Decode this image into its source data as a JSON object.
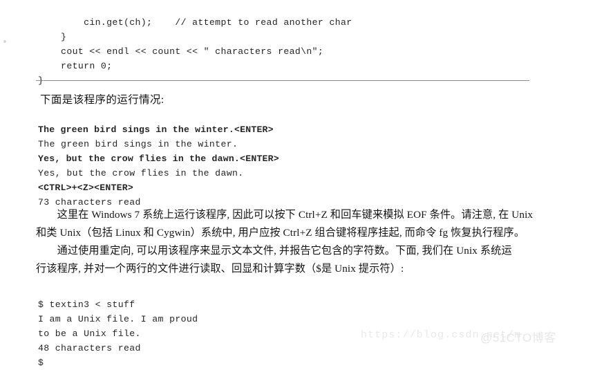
{
  "page": {
    "background_color": "#ffffff",
    "text_color": "#151515",
    "rule_color": "#8d8d8d"
  },
  "code_top": {
    "name": "cpp-source-fragment",
    "lines": [
      "        cin.get(ch);    // attempt to read another char",
      "    }",
      "    cout << endl << count << \" characters read\\n\";",
      "    return 0;",
      "}"
    ]
  },
  "heading": {
    "text": "下面是该程序的运行情况:"
  },
  "run_block": {
    "name": "program-run-transcript",
    "lines": [
      {
        "text": "The green bird sings in the winter.<ENTER>",
        "bold": true
      },
      {
        "text": "The green bird sings in the winter.",
        "bold": false
      },
      {
        "text": "Yes, but the crow flies in the dawn.<ENTER>",
        "bold": true
      },
      {
        "text": "Yes, but the crow flies in the dawn.",
        "bold": false
      },
      {
        "text": "<CTRL>+<Z><ENTER>",
        "bold": true
      },
      {
        "text": "73 characters read",
        "bold": false
      }
    ]
  },
  "paragraph_1": {
    "line_1": "　　这里在 Windows 7 系统上运行该程序, 因此可以按下 Ctrl+Z 和回车键来模拟 EOF 条件。请注意, 在 Unix",
    "line_2": "和类 Unix（包括 Linux 和 Cygwin）系统中, 用户应按 Ctrl+Z 组合键将程序挂起, 而命令 fg 恢复执行程序。"
  },
  "paragraph_2": {
    "line_1": "　　通过使用重定向, 可以用该程序来显示文本文件, 并报告它包含的字符数。下面, 我们在 Unix 系统运",
    "line_2": "行该程序, 并对一个两行的文件进行读取、回显和计算字数（$是 Unix 提示符）:"
  },
  "unix_block": {
    "name": "unix-shell-transcript",
    "lines": [
      "$ textin3 < stuff",
      "I am a Unix file. I am proud",
      "to be a Unix file.",
      "48 characters read",
      "$"
    ]
  },
  "watermarks": {
    "csdn": "https://blog.csdn.net/m",
    "cto": "@51CTO博客"
  }
}
